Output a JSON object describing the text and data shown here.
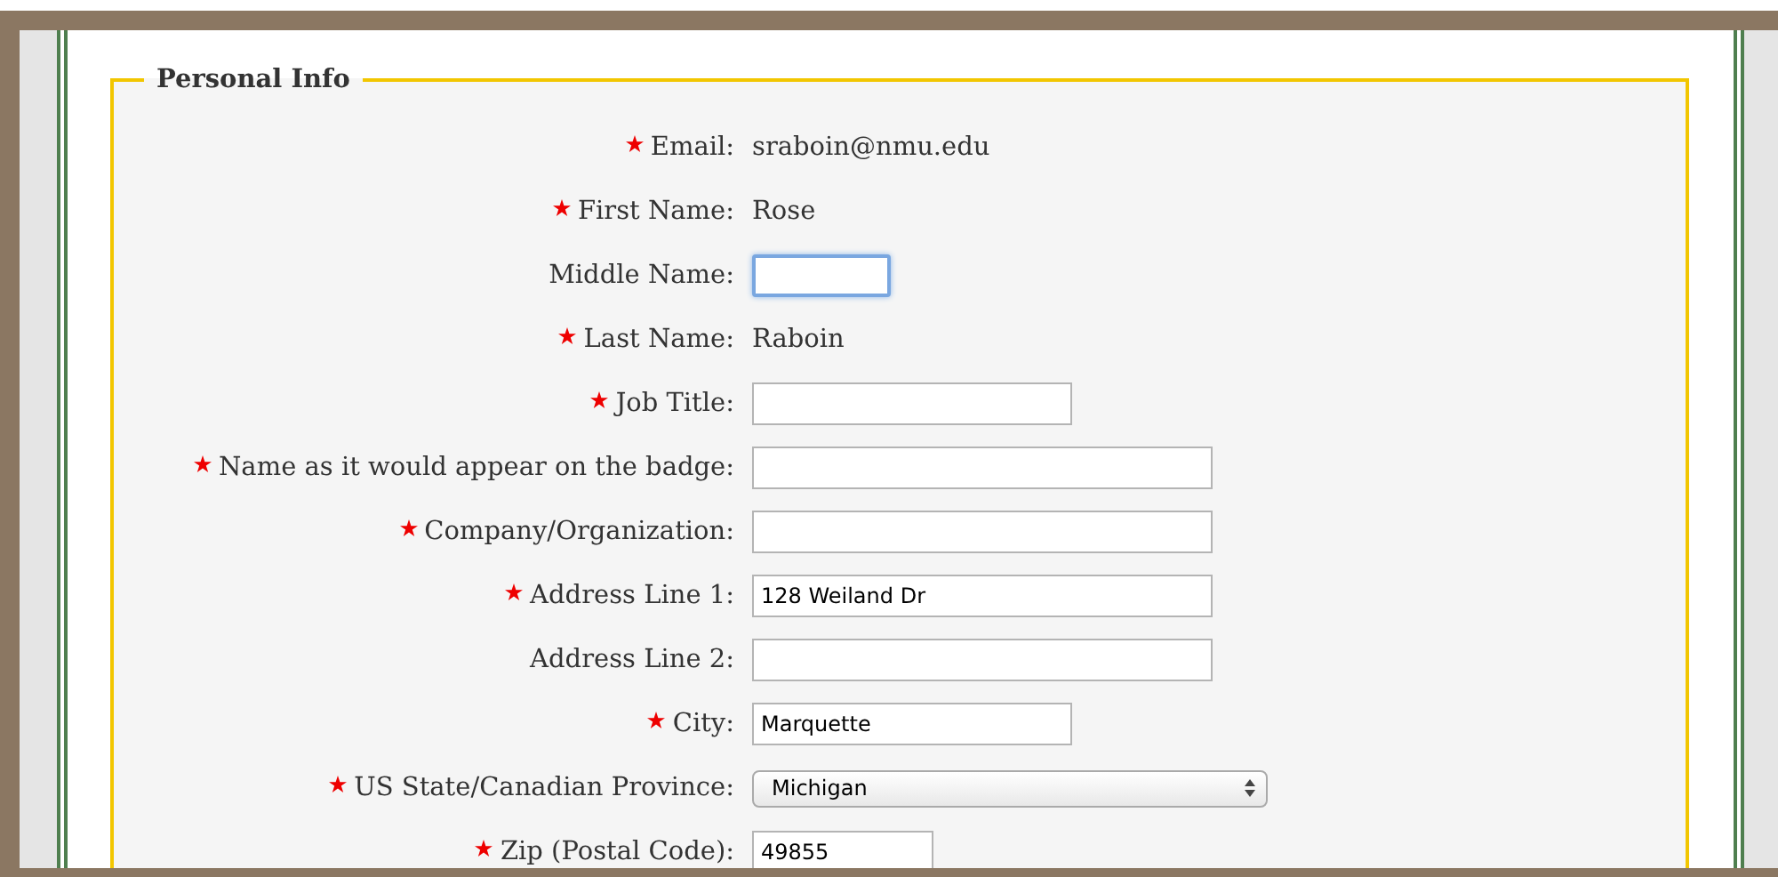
{
  "section": {
    "title": "Personal Info"
  },
  "fields": [
    {
      "label": "Email:",
      "required": true,
      "kind": "text",
      "value": "sraboin@nmu.edu"
    },
    {
      "label": "First Name:",
      "required": true,
      "kind": "text",
      "value": "Rose"
    },
    {
      "label": "Middle Name:",
      "required": false,
      "kind": "input",
      "focused": true
    },
    {
      "label": "Last Name:",
      "required": true,
      "kind": "text",
      "value": "Raboin"
    },
    {
      "label": "Job Title:",
      "required": true,
      "kind": "input",
      "focused": false
    },
    {
      "label": "Name as it would appear on the badge:",
      "required": true,
      "kind": "input",
      "focused": false
    },
    {
      "label": "Company/Organization:",
      "required": true,
      "kind": "input",
      "focused": false
    },
    {
      "label": "Address Line 1:",
      "required": true,
      "kind": "input",
      "value": "128 Weiland Dr",
      "focused": false
    },
    {
      "label": "Address Line 2:",
      "required": false,
      "kind": "input",
      "focused": false
    },
    {
      "label": "City:",
      "required": true,
      "kind": "input",
      "value": "Marquette",
      "focused": false
    },
    {
      "label": "US State/Canadian Province:",
      "required": true,
      "kind": "select",
      "value": "Michigan"
    },
    {
      "label": "Zip (Postal Code):",
      "required": true,
      "kind": "input",
      "value": "49855",
      "focused": false
    }
  ]
}
